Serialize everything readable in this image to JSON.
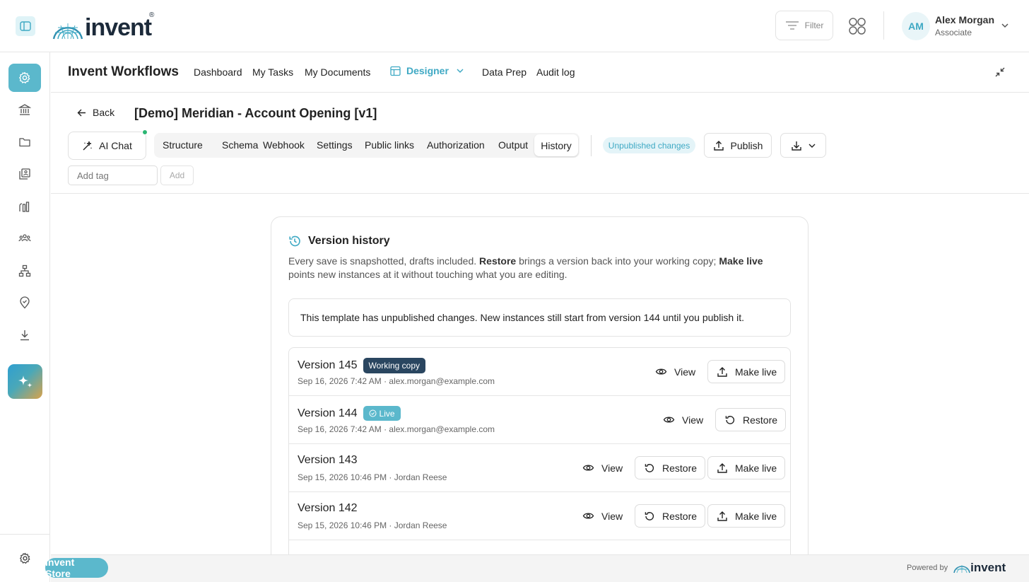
{
  "header": {
    "brand": "invent",
    "brand_reg": "®",
    "filter_label": "Filter",
    "user": {
      "initials": "AM",
      "name": "Alex Morgan",
      "role": "Associate"
    }
  },
  "rail": {
    "items": [
      "settings-cog",
      "bank",
      "folder",
      "library",
      "analytics",
      "team",
      "hierarchy",
      "location-pin",
      "download"
    ],
    "active": "settings-cog"
  },
  "nav": {
    "app_title": "Invent Workflows",
    "links": [
      "Dashboard",
      "My Tasks",
      "My Documents"
    ],
    "designer_label": "Designer",
    "links_after": [
      "Data Prep",
      "Audit log"
    ]
  },
  "page": {
    "back_label": "Back",
    "title": "[Demo] Meridian - Account Opening [v1]",
    "ai_chat_label": "AI Chat",
    "tabs": [
      "Structure",
      "Schema",
      "Webhook",
      "Settings",
      "Public links",
      "Authorization",
      "Output",
      "History"
    ],
    "active_tab": "History",
    "unpublished_badge": "Unpublished changes",
    "publish_label": "Publish",
    "tag_placeholder": "Add tag",
    "tag_add_label": "Add"
  },
  "history": {
    "title": "Version history",
    "desc_1": "Every save is snapshotted, drafts included. ",
    "desc_restore": "Restore",
    "desc_2": " brings a version back into your working copy; ",
    "desc_make_live": "Make live",
    "desc_3": " points new instances at it without touching what you are editing.",
    "notice": "This template has unpublished changes. New instances still start from version 144 until you publish it.",
    "versions": [
      {
        "name": "Version 145",
        "badge": "Working copy",
        "meta": "Sep 16, 2026 7:42 AM · alex.morgan@example.com",
        "view": "View",
        "make_live": "Make live"
      },
      {
        "name": "Version 144",
        "badge": "Live",
        "meta": "Sep 16, 2026 7:42 AM · alex.morgan@example.com",
        "view": "View",
        "restore": "Restore"
      },
      {
        "name": "Version 143",
        "meta": "Sep 15, 2026 10:46 PM · Jordan Reese",
        "view": "View",
        "restore": "Restore",
        "make_live": "Make live"
      },
      {
        "name": "Version 142",
        "meta": "Sep 15, 2026 10:46 PM · Jordan Reese",
        "view": "View",
        "restore": "Restore",
        "make_live": "Make live"
      }
    ]
  },
  "footer": {
    "store_label": "Invent Store",
    "powered_by": "Powered by",
    "powered_brand": "invent"
  },
  "colors": {
    "accent": "#5bb8cc",
    "accent_text": "#3fa9c4",
    "dark_badge": "#2a4660",
    "live_dot": "#2bb673"
  }
}
